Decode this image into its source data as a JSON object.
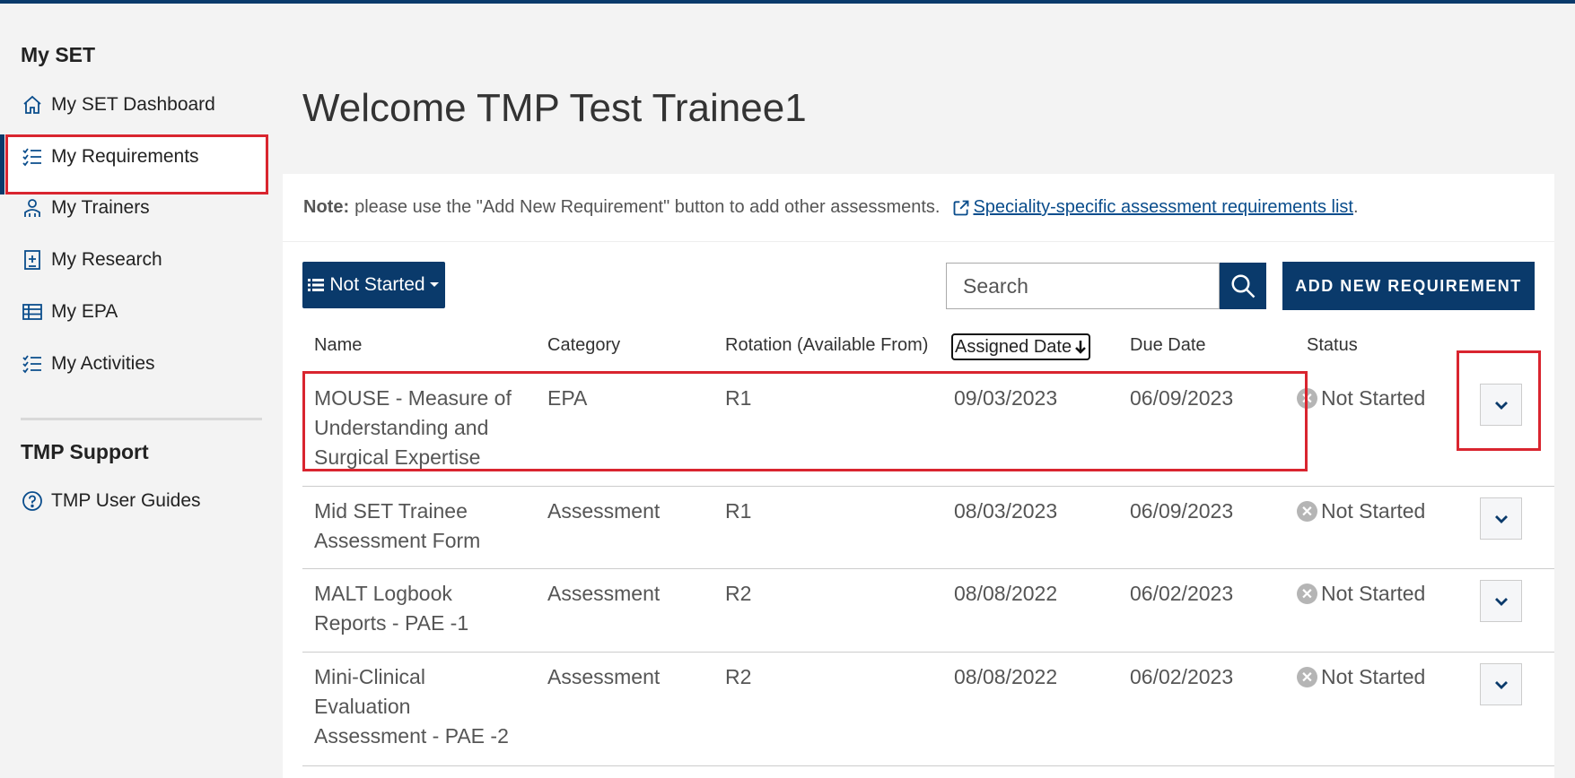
{
  "sidebar": {
    "section1_title": "My SET",
    "items": [
      {
        "label": "My SET Dashboard",
        "icon": "home-icon"
      },
      {
        "label": "My Requirements",
        "icon": "checklist-icon"
      },
      {
        "label": "My Trainers",
        "icon": "users-icon"
      },
      {
        "label": "My Research",
        "icon": "document-plus-icon"
      },
      {
        "label": "My EPA",
        "icon": "table-icon"
      },
      {
        "label": "My Activities",
        "icon": "checklist-icon"
      }
    ],
    "section2_title": "TMP Support",
    "support_items": [
      {
        "label": "TMP User Guides",
        "icon": "help-circle-icon"
      }
    ]
  },
  "main": {
    "welcome": "Welcome TMP Test Trainee1",
    "note_label": "Note:",
    "note_text": "please use the \"Add New Requirement\" button to add other assessments.",
    "note_link": "Speciality-specific assessment requirements list",
    "note_period": ".",
    "filter_label": "Not Started",
    "search_placeholder": "Search",
    "add_button": "ADD NEW REQUIREMENT",
    "columns": [
      "Name",
      "Category",
      "Rotation (Available From)",
      "Assigned Date",
      "Due Date",
      "Status"
    ],
    "rows": [
      {
        "name": [
          "MOUSE - Measure of",
          "Understanding and",
          "Surgical Expertise"
        ],
        "category": "EPA",
        "rotation": "R1",
        "assigned": "09/03/2023",
        "due": "06/09/2023",
        "status": "Not Started"
      },
      {
        "name": [
          "Mid SET Trainee",
          "Assessment Form"
        ],
        "category": "Assessment",
        "rotation": "R1",
        "assigned": "08/03/2023",
        "due": "06/09/2023",
        "status": "Not Started"
      },
      {
        "name": [
          "MALT Logbook",
          "Reports - PAE -1"
        ],
        "category": "Assessment",
        "rotation": "R2",
        "assigned": "08/08/2022",
        "due": "06/02/2023",
        "status": "Not Started"
      },
      {
        "name": [
          "Mini-Clinical",
          "Evaluation",
          "Assessment - PAE -2"
        ],
        "category": "Assessment",
        "rotation": "R2",
        "assigned": "08/08/2022",
        "due": "06/02/2023",
        "status": "Not Started"
      }
    ]
  },
  "colors": {
    "brand": "#0a3a6b",
    "highlight": "#d9252f"
  }
}
